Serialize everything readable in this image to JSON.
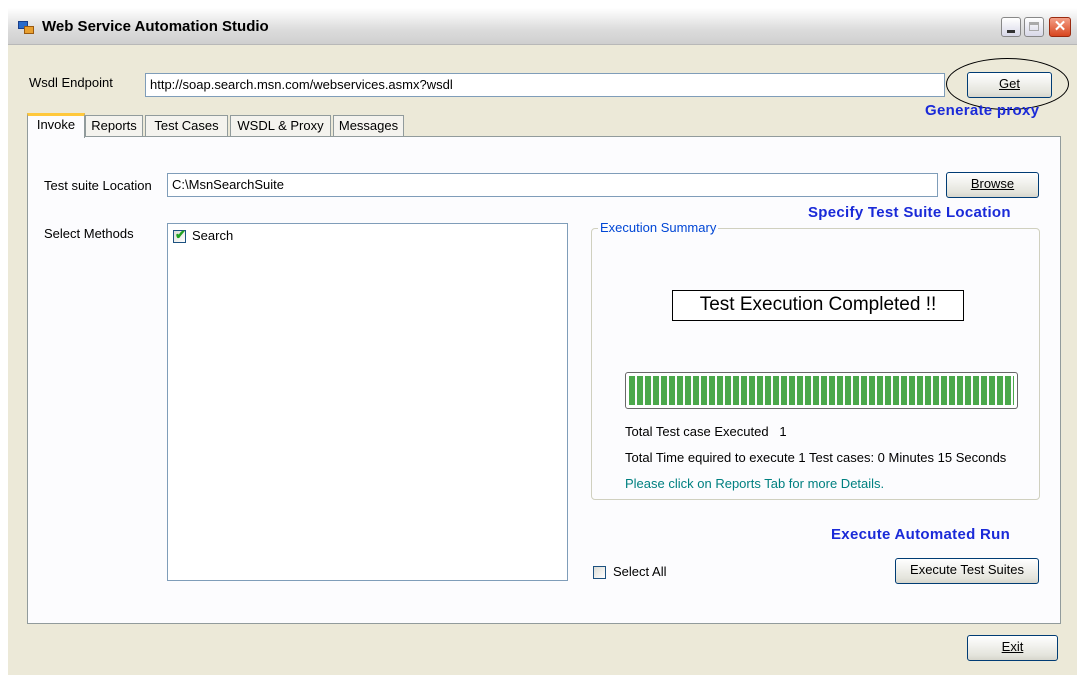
{
  "window": {
    "title": "Web Service Automation Studio",
    "close_glyph": "✕"
  },
  "wsdl": {
    "label": "Wsdl Endpoint",
    "value": "http://soap.search.msn.com/webservices.asmx?wsdl",
    "get_button": "Get"
  },
  "annotations": {
    "generate_proxy": "Generate proxy",
    "specify_location": "Specify Test Suite Location",
    "execute_run": "Execute Automated Run"
  },
  "tabs": [
    {
      "label": "Invoke",
      "active": true
    },
    {
      "label": "Reports",
      "active": false
    },
    {
      "label": "Test Cases",
      "active": false
    },
    {
      "label": "WSDL & Proxy",
      "active": false
    },
    {
      "label": "Messages",
      "active": false
    }
  ],
  "invoke": {
    "location_label": "Test suite Location",
    "location_value": "C:\\MsnSearchSuite",
    "browse_button": "Browse",
    "methods_label": "Select Methods",
    "methods": [
      {
        "label": "Search",
        "checked": true
      }
    ],
    "select_all_label": "Select All",
    "select_all_checked": false,
    "execute_button": "Execute Test Suites"
  },
  "summary": {
    "legend": "Execution Summary",
    "status": "Test Execution Completed !!",
    "progress_percent": 100,
    "executed_line": "Total Test case Executed   1",
    "time_line": "Total Time equired to execute 1 Test cases: 0 Minutes 15 Seconds",
    "note": "Please click on Reports Tab for more Details."
  },
  "footer": {
    "exit_button": "Exit"
  },
  "colors": {
    "annotation": "#1a2ad8",
    "progress": "#4ba84b",
    "note": "#008080",
    "active_tab": "#ffc83c"
  },
  "icons": {
    "checkmark": "✔"
  }
}
